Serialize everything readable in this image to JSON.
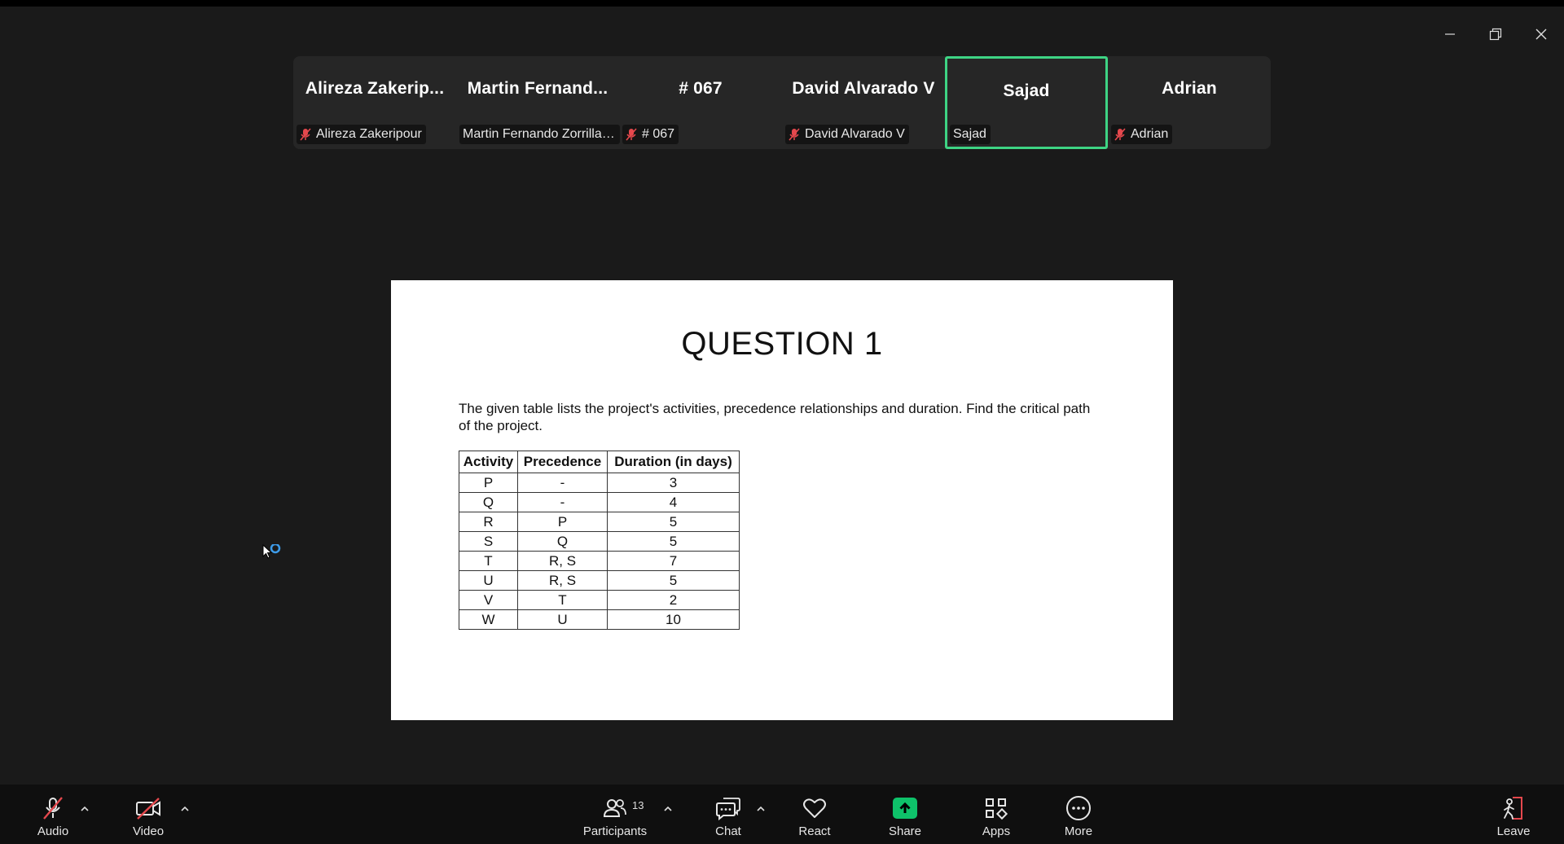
{
  "window": {
    "controls": [
      "minimize-icon",
      "restore-icon",
      "close-icon"
    ]
  },
  "participants_strip": [
    {
      "display_name": "Alireza  Zakerip...",
      "label": "Alireza Zakeripour",
      "muted": true,
      "active": false
    },
    {
      "display_name": "Martin  Fernand...",
      "label": "Martin Fernando Zorrilla ...",
      "muted": false,
      "active": false
    },
    {
      "display_name": "# 067",
      "label": "# 067",
      "muted": true,
      "active": false
    },
    {
      "display_name": "David Alvarado V",
      "label": "David Alvarado V",
      "muted": true,
      "active": false
    },
    {
      "display_name": "Sajad",
      "label": "Sajad",
      "muted": false,
      "active": true
    },
    {
      "display_name": "Adrian",
      "label": "Adrian",
      "muted": true,
      "active": false
    }
  ],
  "slide": {
    "title": "QUESTION 1",
    "text": "The given table lists the project's activities, precedence relationships and duration. Find the critical path of the project.",
    "table": {
      "headers": [
        "Activity",
        "Precedence",
        "Duration (in days)"
      ],
      "rows": [
        [
          "P",
          "-",
          "3"
        ],
        [
          "Q",
          "-",
          "4"
        ],
        [
          "R",
          "P",
          "5"
        ],
        [
          "S",
          "Q",
          "5"
        ],
        [
          "T",
          "R, S",
          "7"
        ],
        [
          "U",
          "R, S",
          "5"
        ],
        [
          "V",
          "T",
          "2"
        ],
        [
          "W",
          "U",
          "10"
        ]
      ]
    }
  },
  "toolbar": {
    "audio": "Audio",
    "video": "Video",
    "participants": "Participants",
    "participants_count": "13",
    "chat": "Chat",
    "react": "React",
    "share": "Share",
    "apps": "Apps",
    "more": "More",
    "leave": "Leave"
  },
  "colors": {
    "active_speaker": "#3ed484",
    "share_green": "#0ec26a",
    "muted_red": "#e5484d"
  }
}
